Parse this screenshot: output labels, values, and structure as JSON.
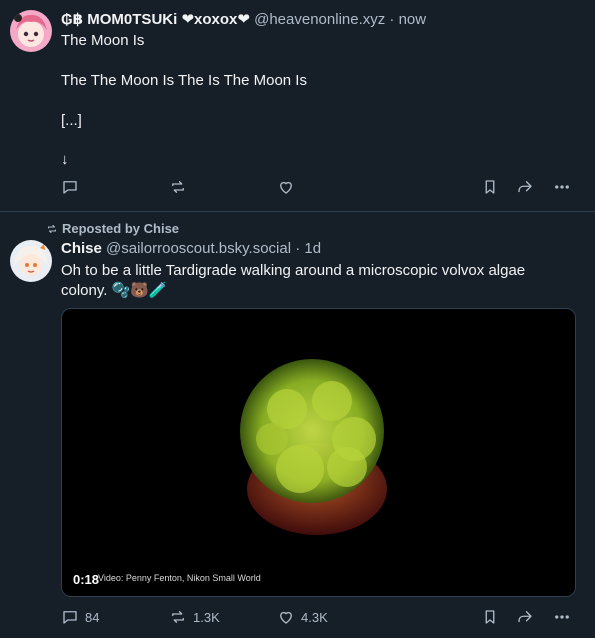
{
  "post1": {
    "display_name": "₲฿ MOM0TSUKi ❤xoxox❤",
    "handle": "@heavenonline.xyz",
    "dot": "·",
    "time": "now",
    "lines": [
      "The Moon Is",
      "The The Moon Is The Is The Moon Is",
      "[...]",
      "↓"
    ],
    "actions": {
      "reply_count": "",
      "repost_count": "",
      "like_count": ""
    }
  },
  "post2": {
    "repost_label": "Reposted by Chise",
    "display_name": "Chise",
    "handle": "@sailorrooscout.bsky.social",
    "dot": "·",
    "time": "1d",
    "text": "Oh to be a little Tardigrade walking around a microscopic volvox algae colony. 🫧🐻🧪",
    "video": {
      "duration": "0:18",
      "credit": "Video: Penny Fenton, Nikon Small World"
    },
    "actions": {
      "reply_count": "84",
      "repost_count": "1.3K",
      "like_count": "4.3K"
    }
  },
  "colors": {
    "background": "#161e27",
    "muted": "#aebbc9",
    "divider": "#2e4052"
  },
  "icons": [
    "reply-icon",
    "repost-icon",
    "like-icon",
    "bookmark-icon",
    "share-icon",
    "more-icon"
  ]
}
